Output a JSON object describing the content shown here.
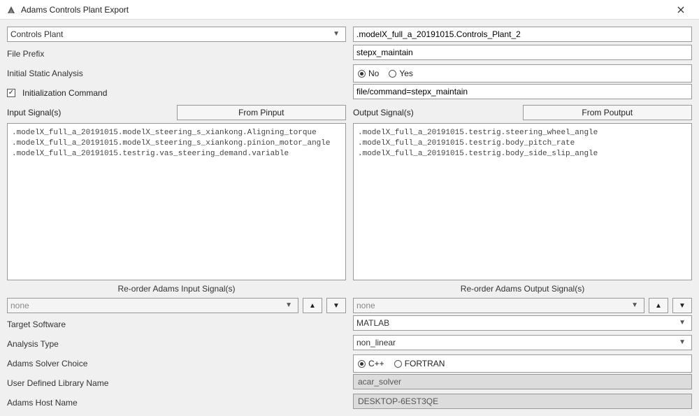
{
  "window": {
    "title": "Adams Controls Plant Export"
  },
  "top": {
    "export_type": "Controls Plant",
    "plant_path": ".modelX_full_a_20191015.Controls_Plant_2"
  },
  "labels": {
    "file_prefix": "File Prefix",
    "initial_static": "Initial Static Analysis",
    "init_cmd": "Initialization Command",
    "input_signals": "Input Signal(s)",
    "output_signals": "Output Signal(s)",
    "from_pinput": "From Pinput",
    "from_poutput": "From Poutput",
    "reorder_in": "Re-order Adams Input Signal(s)",
    "reorder_out": "Re-order Adams Output Signal(s)",
    "target_software": "Target Software",
    "analysis_type": "Analysis Type",
    "solver_choice": "Adams Solver Choice",
    "user_lib": "User Defined Library Name",
    "host_name": "Adams Host Name"
  },
  "fields": {
    "file_prefix": "stepx_maintain",
    "initial_static": {
      "no": "No",
      "yes": "Yes",
      "selected": "no"
    },
    "init_cmd_checked": true,
    "init_cmd_value": "file/command=stepx_maintain",
    "target_software": "MATLAB",
    "analysis_type": "non_linear",
    "solver": {
      "cpp": "C++",
      "fortran": "FORTRAN",
      "selected": "cpp"
    },
    "user_lib": "acar_solver",
    "host_name": "DESKTOP-6EST3QE",
    "reorder_in": "none",
    "reorder_out": "none"
  },
  "input_signals": [
    ".modelX_full_a_20191015.modelX_steering_s_xiankong.Aligning_torque",
    ".modelX_full_a_20191015.modelX_steering_s_xiankong.pinion_motor_angle",
    ".modelX_full_a_20191015.testrig.vas_steering_demand.variable"
  ],
  "output_signals": [
    ".modelX_full_a_20191015.testrig.steering_wheel_angle",
    ".modelX_full_a_20191015.testrig.body_pitch_rate",
    ".modelX_full_a_20191015.testrig.body_side_slip_angle"
  ]
}
